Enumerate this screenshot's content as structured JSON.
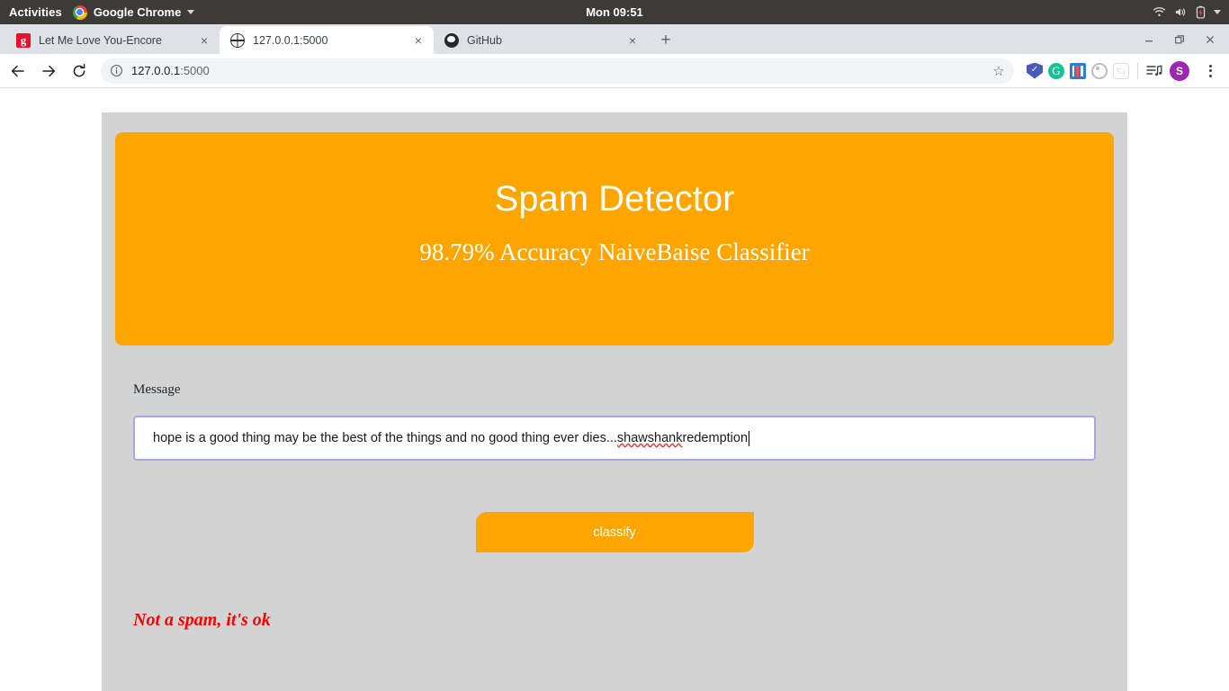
{
  "os_bar": {
    "activities": "Activities",
    "app_name": "Google Chrome",
    "app_menu_caret": "chevron-down-icon",
    "clock": "Mon 09:51",
    "tray": [
      "wifi-icon",
      "volume-icon",
      "battery-charging-icon",
      "chevron-down-icon"
    ]
  },
  "browser": {
    "tabs": [
      {
        "title": "Let Me Love You-Encore",
        "favicon": "gaana-icon",
        "active": false,
        "close": "×"
      },
      {
        "title": "127.0.0.1:5000",
        "favicon": "globe-icon",
        "active": true,
        "close": "×"
      },
      {
        "title": "GitHub",
        "favicon": "github-icon",
        "active": false,
        "close": "×"
      }
    ],
    "new_tab_label": "+",
    "window_controls": {
      "minimize": "–",
      "restore": "❐",
      "close": "×"
    },
    "nav": {
      "back": "←",
      "forward": "→",
      "reload": "⟳"
    },
    "omnibox": {
      "site_info_icon": "info-circle-icon",
      "url_host": "127.0.0.1",
      "url_port": ":5000",
      "bookmark_icon": "☆"
    },
    "extensions": [
      {
        "name": "shield-extension-icon",
        "glyph": "✓"
      },
      {
        "name": "grammarly-extension-icon",
        "glyph": "G"
      },
      {
        "name": "ie-tab-extension-icon",
        "glyph": ""
      },
      {
        "name": "ring-extension-icon",
        "glyph": ""
      },
      {
        "name": "react-devtools-extension-icon",
        "glyph": ""
      }
    ],
    "playlist_icon": "♫",
    "profile_initial": "S",
    "menu_icon": "kebab-menu-icon"
  },
  "page": {
    "title": "Spam Detector",
    "subtitle": "98.79% Accuracy NaiveBaise Classifier",
    "message_label": "Message",
    "message_value_before": "hope is a good thing may be the best of the things and no good thing ever dies...",
    "message_value_misspelled": "shawshank",
    "message_value_after": " redemption",
    "message_placeholder": "",
    "classify_label": "classify",
    "result": "Not a spam, it's ok",
    "colors": {
      "accent_orange": "#ffa500",
      "page_background": "#d3d3d3",
      "result_red": "#ff0000",
      "input_border": "#a7a7e4"
    }
  }
}
